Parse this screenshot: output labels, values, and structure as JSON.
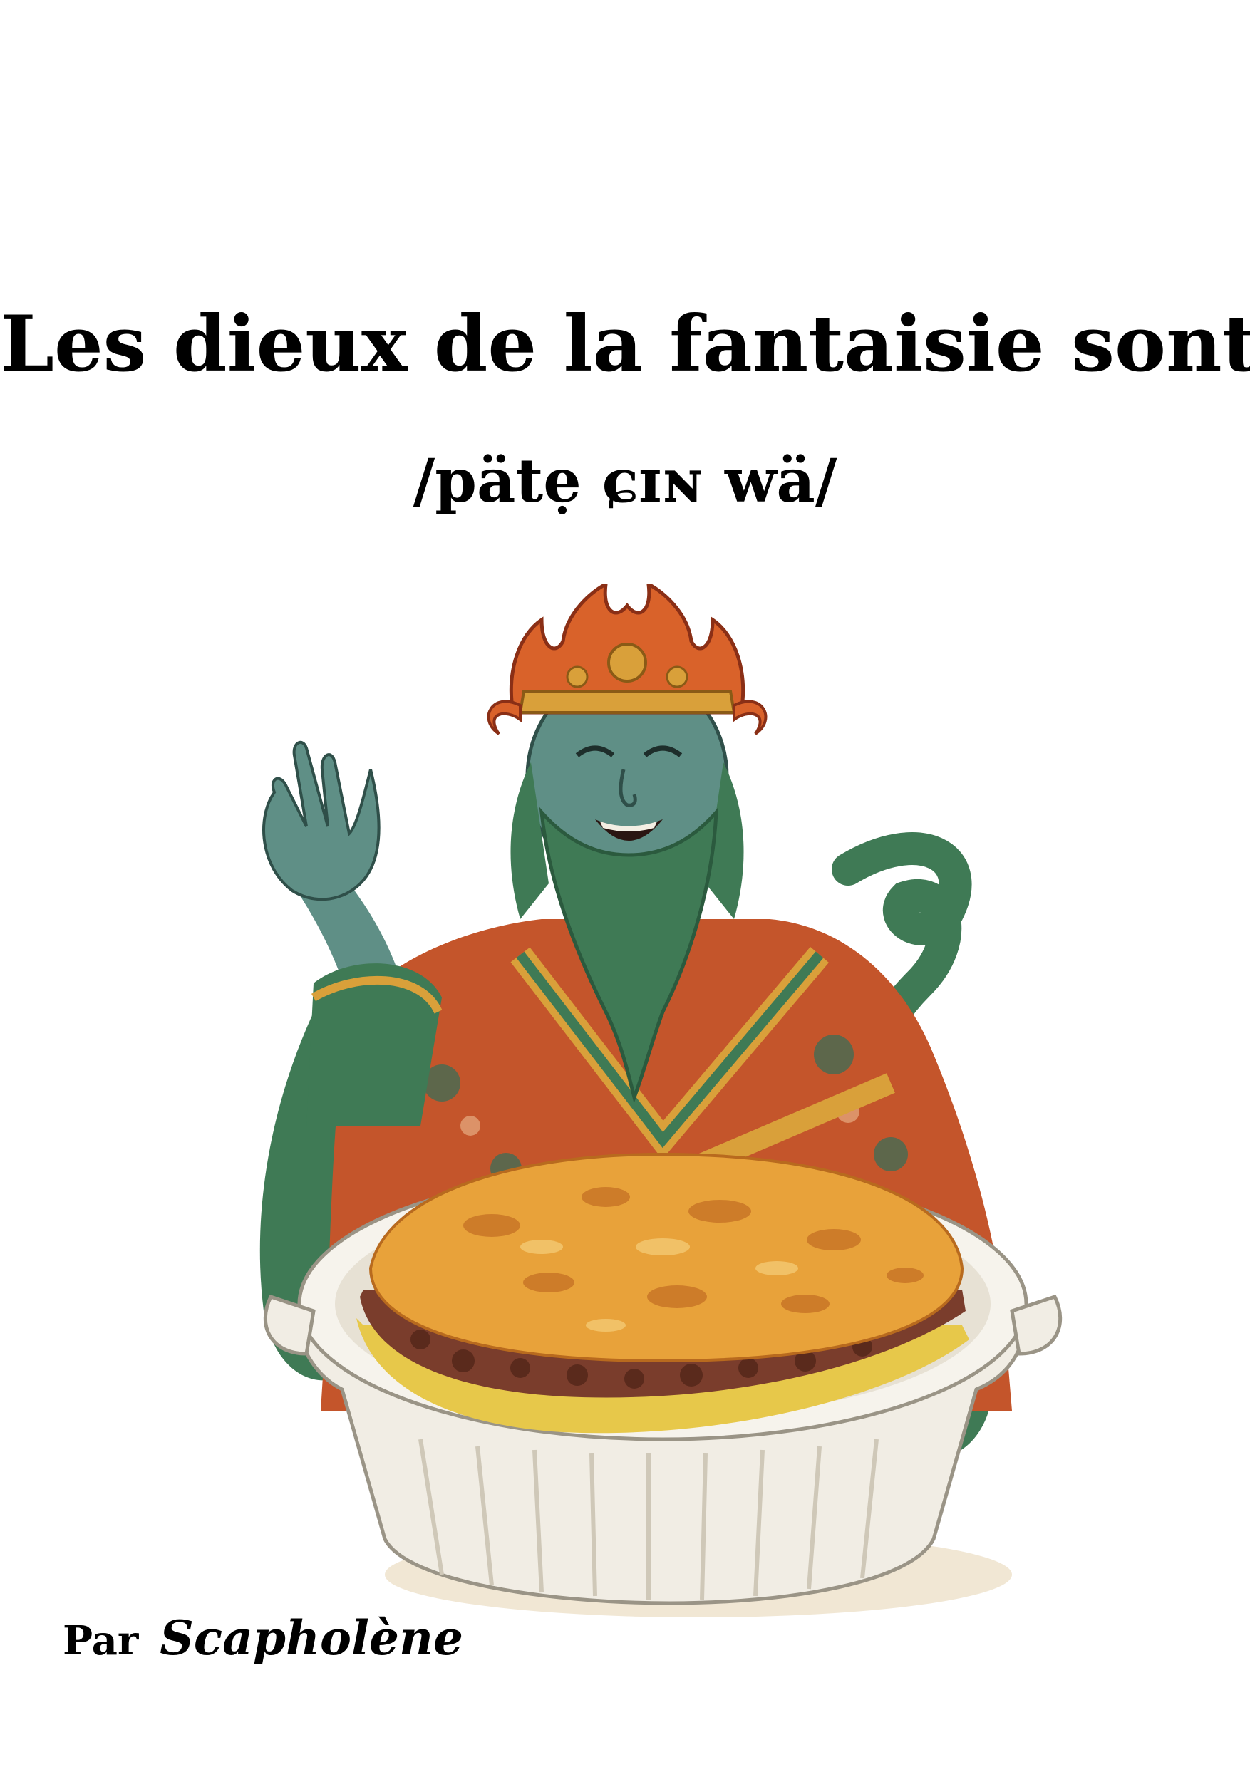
{
  "cover": {
    "title": "Les dieux de la fantaisie sont",
    "phonetic": "/pätẹ ɕɪɴ wä/",
    "byline_prefix": "Par",
    "author": "Scapholène"
  },
  "illustration": {
    "subject": "deity-with-shepherds-pie-icon",
    "colors": {
      "skin": "#5f8f86",
      "beard": "#3f7a55",
      "robe": "#c4552b",
      "robe_pattern": "#3b6e57",
      "crown": "#d9622a",
      "gold": "#d9a03a",
      "dish": "#f1ede4",
      "crust": "#e8a23a",
      "meat": "#7a3d2c",
      "corn": "#e7c84a"
    }
  }
}
